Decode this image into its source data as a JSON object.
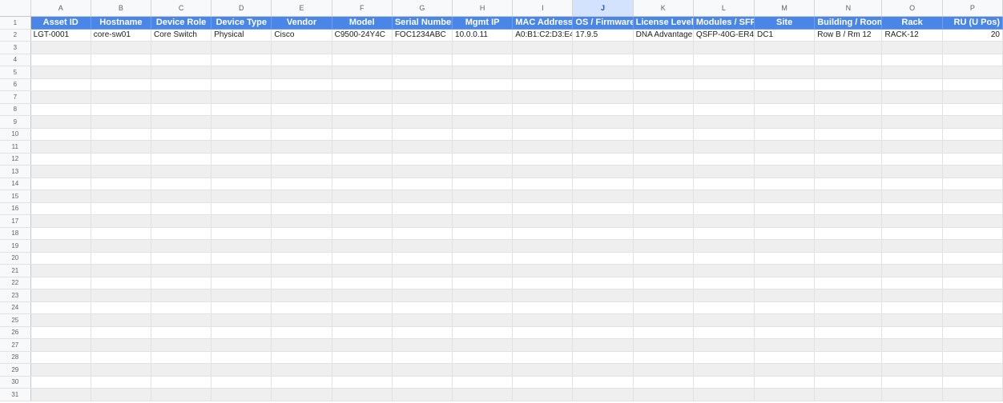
{
  "columns": [
    "A",
    "B",
    "C",
    "D",
    "E",
    "F",
    "G",
    "H",
    "I",
    "J",
    "K",
    "L",
    "M",
    "N",
    "O",
    "P"
  ],
  "active_column": "J",
  "header_fill_color": "#4a86e8",
  "banding_color": "#efefef",
  "headers": [
    "Asset ID",
    "Hostname",
    "Device Role",
    "Device Type",
    "Vendor",
    "Model",
    "Serial Number",
    "Mgmt IP",
    "MAC Address",
    "OS / Firmware",
    "License Level",
    "Modules / SFPs",
    "Site",
    "Building / Room",
    "Rack",
    "RU (U Pos)"
  ],
  "rows": [
    [
      "LGT-0001",
      "core-sw01",
      "Core Switch",
      "Physical",
      "Cisco",
      "C9500-24Y4C",
      "FOC1234ABC",
      "10.0.0.11",
      "A0:B1:C2:D3:E4:",
      "17.9.5",
      "DNA Advantage",
      "QSFP-40G-ER4",
      "DC1",
      "Row B / Rm 12",
      "RACK-12",
      "20"
    ]
  ],
  "row_numbers": [
    "1",
    "2",
    "3",
    "4",
    "5",
    "6",
    "7",
    "8",
    "9",
    "10",
    "11",
    "12",
    "13",
    "14",
    "15",
    "16",
    "17",
    "18",
    "19",
    "20",
    "21",
    "22",
    "23",
    "24",
    "25",
    "26",
    "27",
    "28",
    "29",
    "30",
    "31"
  ]
}
